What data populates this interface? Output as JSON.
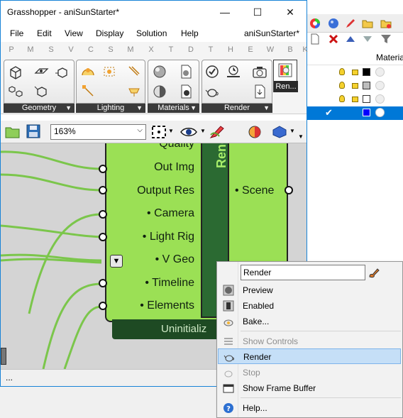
{
  "window": {
    "title": "Grasshopper - aniSunStarter*",
    "minimize": "—",
    "maximize": "☐",
    "close": "✕"
  },
  "menu": {
    "items": [
      "File",
      "Edit",
      "View",
      "Display",
      "Solution",
      "Help"
    ],
    "document_name": "aniSunStarter*"
  },
  "tab_letters": [
    "P",
    "M",
    "S",
    "V",
    "C",
    "S",
    "M",
    "X",
    "T",
    "D",
    "T",
    "H",
    "E",
    "W",
    "B",
    "K"
  ],
  "ribbon": {
    "groups": [
      {
        "label": "Geometry"
      },
      {
        "label": "Lighting"
      },
      {
        "label": "Materials"
      },
      {
        "label": "Render"
      }
    ],
    "render_button_label": "Ren..."
  },
  "toolbar": {
    "zoom_value": "163%"
  },
  "rhino_panel": {
    "material_header": "Materia",
    "colors": {
      "selection": "#0078d7"
    }
  },
  "component": {
    "name": "Render",
    "inputs": [
      "Quality",
      "Out Img",
      "Output Res",
      "• Camera",
      "• Light Rig",
      "• V Geo",
      "• Timeline",
      "• Elements"
    ],
    "output": "• Scene",
    "status": "Uninitializ",
    "colors": {
      "body": "#9be055",
      "name_bar": "#2b6a32"
    }
  },
  "context_menu": {
    "name_value": "Render",
    "items": [
      {
        "label": "Preview"
      },
      {
        "label": "Enabled"
      },
      {
        "label": "Bake..."
      },
      {
        "label": "Show Controls"
      },
      {
        "label": "Render"
      },
      {
        "label": "Stop"
      },
      {
        "label": "Show Frame Buffer"
      },
      {
        "label": "Help..."
      }
    ]
  },
  "status_bar": {
    "text": "..."
  }
}
